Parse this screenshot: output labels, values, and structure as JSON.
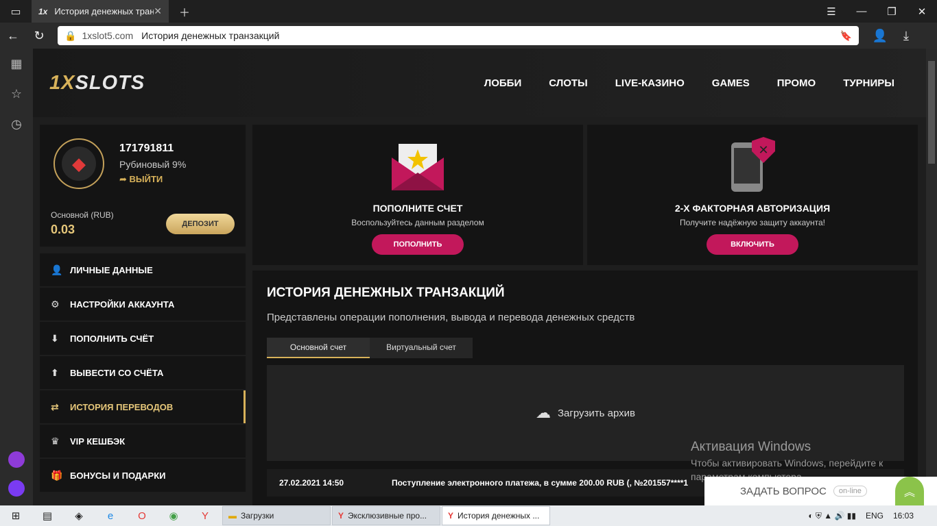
{
  "browser": {
    "tab_title": "История денежных транзакций",
    "tab_icon": "1x",
    "url_host": "1xslot5.com",
    "url_title": "История денежных транзакций"
  },
  "header": {
    "logo_prefix": "1X",
    "logo_rest": "SLOTS",
    "menu": [
      "ЛОББИ",
      "СЛОТЫ",
      "LIVE-КАЗИНО",
      "GAMES",
      "ПРОМО",
      "ТУРНИРЫ"
    ]
  },
  "profile": {
    "id": "171791811",
    "level": "Рубиновый 9%",
    "logout": "ВЫЙТИ",
    "balance_label": "Основной (RUB)",
    "balance_value": "0.03",
    "deposit_button": "ДЕПОЗИТ"
  },
  "left_menu": [
    {
      "label": "ЛИЧНЫЕ ДАННЫЕ",
      "icon": "user-plus-icon",
      "glyph": "👤"
    },
    {
      "label": "НАСТРОЙКИ АККАУНТА",
      "icon": "gears-icon",
      "glyph": "⚙"
    },
    {
      "label": "ПОПОЛНИТЬ СЧЁТ",
      "icon": "download-icon",
      "glyph": "⬇"
    },
    {
      "label": "ВЫВЕСТИ СО СЧЁТА",
      "icon": "upload-icon",
      "glyph": "⬆"
    },
    {
      "label": "ИСТОРИЯ ПЕРЕВОДОВ",
      "icon": "exchange-icon",
      "glyph": "⇄"
    },
    {
      "label": "VIP КЕШБЭК",
      "icon": "crown-icon",
      "glyph": "♛"
    },
    {
      "label": "БОНУСЫ И ПОДАРКИ",
      "icon": "gift-icon",
      "glyph": "🎁"
    }
  ],
  "cards": {
    "deposit": {
      "title": "ПОПОЛНИТЕ СЧЕТ",
      "subtitle": "Воспользуйтесь данным разделом",
      "button": "ПОПОЛНИТЬ"
    },
    "twofa": {
      "title": "2-Х ФАКТОРНАЯ АВТОРИЗАЦИЯ",
      "subtitle": "Получите надёжную защиту аккаунта!",
      "button": "ВКЛЮЧИТЬ"
    }
  },
  "history": {
    "title": "ИСТОРИЯ ДЕНЕЖНЫХ ТРАНЗАКЦИЙ",
    "subtitle": "Представлены операции пополнения, вывода и перевода денежных средств",
    "tabs": [
      "Основной счет",
      "Виртуальный счет"
    ],
    "archive": "Загрузить архив",
    "rows": [
      {
        "date": "27.02.2021 14:50",
        "text": "Поступление электронного платежа, в сумме 200.00 RUB (, №201557****1"
      }
    ]
  },
  "watermark": {
    "title": "Активация Windows",
    "text": "Чтобы активировать Windows, перейдите к параметрам компьютера."
  },
  "chat": {
    "label": "ЗАДАТЬ ВОПРОС",
    "status": "on-line"
  },
  "taskbar": {
    "apps": [
      "Загрузки",
      "Эксклюзивные про...",
      "История денежных ..."
    ],
    "lang": "ENG",
    "time": "16:03"
  },
  "colors": {
    "accent": "#d8b25a",
    "button": "#c2185b"
  }
}
